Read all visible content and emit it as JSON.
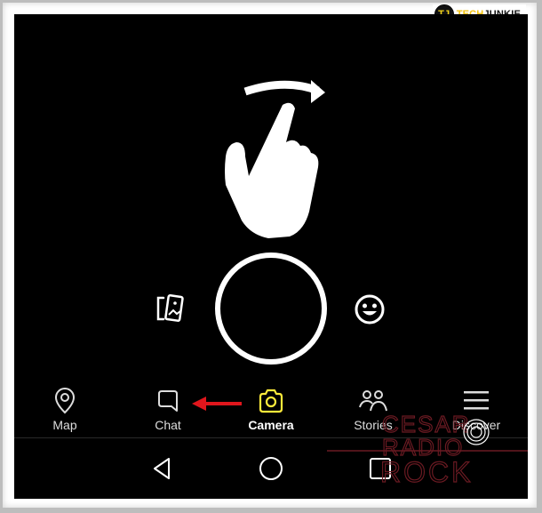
{
  "watermark_badge": {
    "logo_letters": "TJ",
    "brand_part1": "TECH",
    "brand_part2": "JUNKIE"
  },
  "camera": {
    "gesture_hint": "swipe-finger-hand-icon",
    "left_control": "memories-icon",
    "shutter": "shutter-button",
    "right_control": "lenses-smiley-icon"
  },
  "bottom_nav": {
    "items": [
      {
        "label": "Map",
        "icon": "map-pin-icon",
        "active": false
      },
      {
        "label": "Chat",
        "icon": "chat-bubble-icon",
        "active": false
      },
      {
        "label": "Camera",
        "icon": "camera-icon",
        "active": true
      },
      {
        "label": "Stories",
        "icon": "stories-people-icon",
        "active": false
      },
      {
        "label": "Discover",
        "icon": "discover-menu-icon",
        "active": false
      }
    ],
    "accent_color": "#ffeb3b"
  },
  "annotation": {
    "arrow_color": "#e0161c",
    "points_to": "Chat"
  },
  "system_nav": {
    "buttons": [
      "back",
      "home",
      "recents"
    ]
  },
  "overlay_watermark": {
    "lines": [
      "CESAR",
      "RADIO",
      "ROCK"
    ],
    "color": "#6a1a22"
  }
}
